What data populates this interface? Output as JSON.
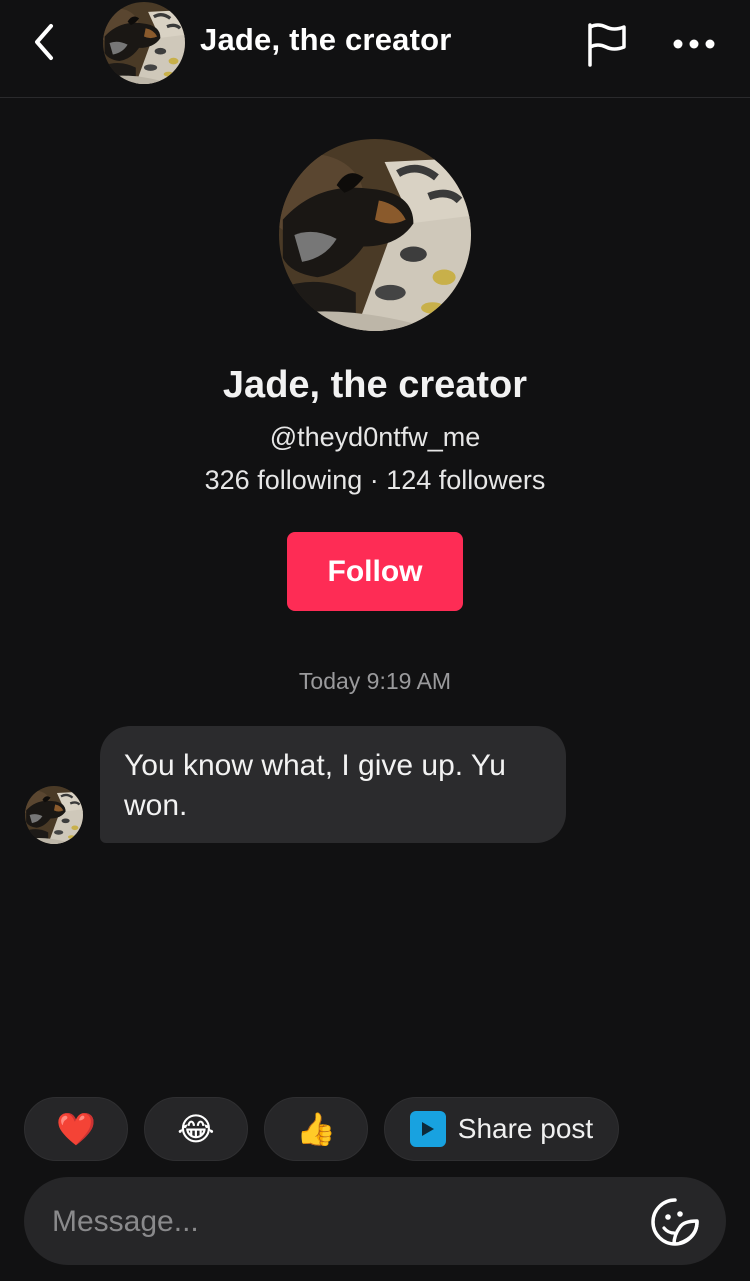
{
  "header": {
    "title": "Jade, the creator",
    "back_icon": "chevron-left-icon",
    "flag_icon": "flag-icon",
    "more_icon": "more-horizontal-icon"
  },
  "profile": {
    "name": "Jade, the creator",
    "handle": "@theyd0ntfw_me",
    "stats": "326 following · 124 followers",
    "follow_label": "Follow"
  },
  "conversation": {
    "timestamp": "Today 9:19 AM",
    "messages": [
      {
        "text": "You know what, I give up. Yu won."
      }
    ]
  },
  "quick_replies": {
    "heart": "❤️",
    "laugh": "😂",
    "thumbs_up": "👍",
    "share_label": "Share post"
  },
  "composer": {
    "placeholder": "Message...",
    "sticker_icon": "sticker-icon"
  },
  "colors": {
    "background": "#111112",
    "accent": "#fe2c55",
    "bubble": "#2b2b2d",
    "share_icon": "#18a2e0"
  }
}
